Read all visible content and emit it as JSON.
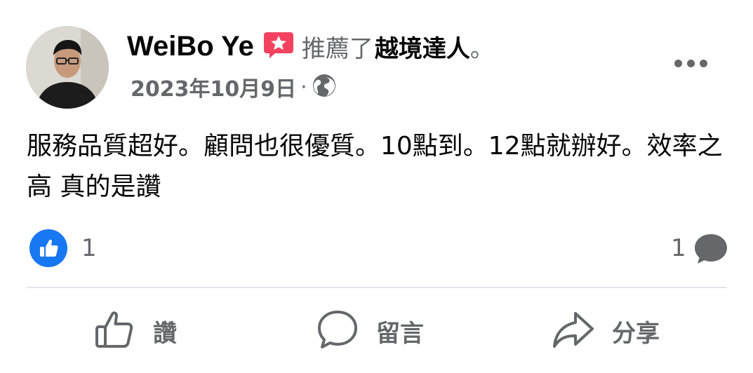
{
  "post": {
    "author": "WeiBo Ye",
    "verb": "推薦了",
    "page_name": "越境達人",
    "period": "。",
    "date": "2023年10月9日",
    "separator": "·",
    "privacy_icon": "globe-icon",
    "body": "服務品質超好。顧問也很優質。10點到。12點就辦好。效率之高 真的是讚"
  },
  "reactions": {
    "like_count": "1",
    "comment_count": "1"
  },
  "actions": {
    "like_label": "讚",
    "comment_label": "留言",
    "share_label": "分享"
  },
  "colors": {
    "accent": "#1877f2",
    "recommend_badge": "#f3425f",
    "secondary_text": "#65676b",
    "divider": "#e4e6eb"
  }
}
